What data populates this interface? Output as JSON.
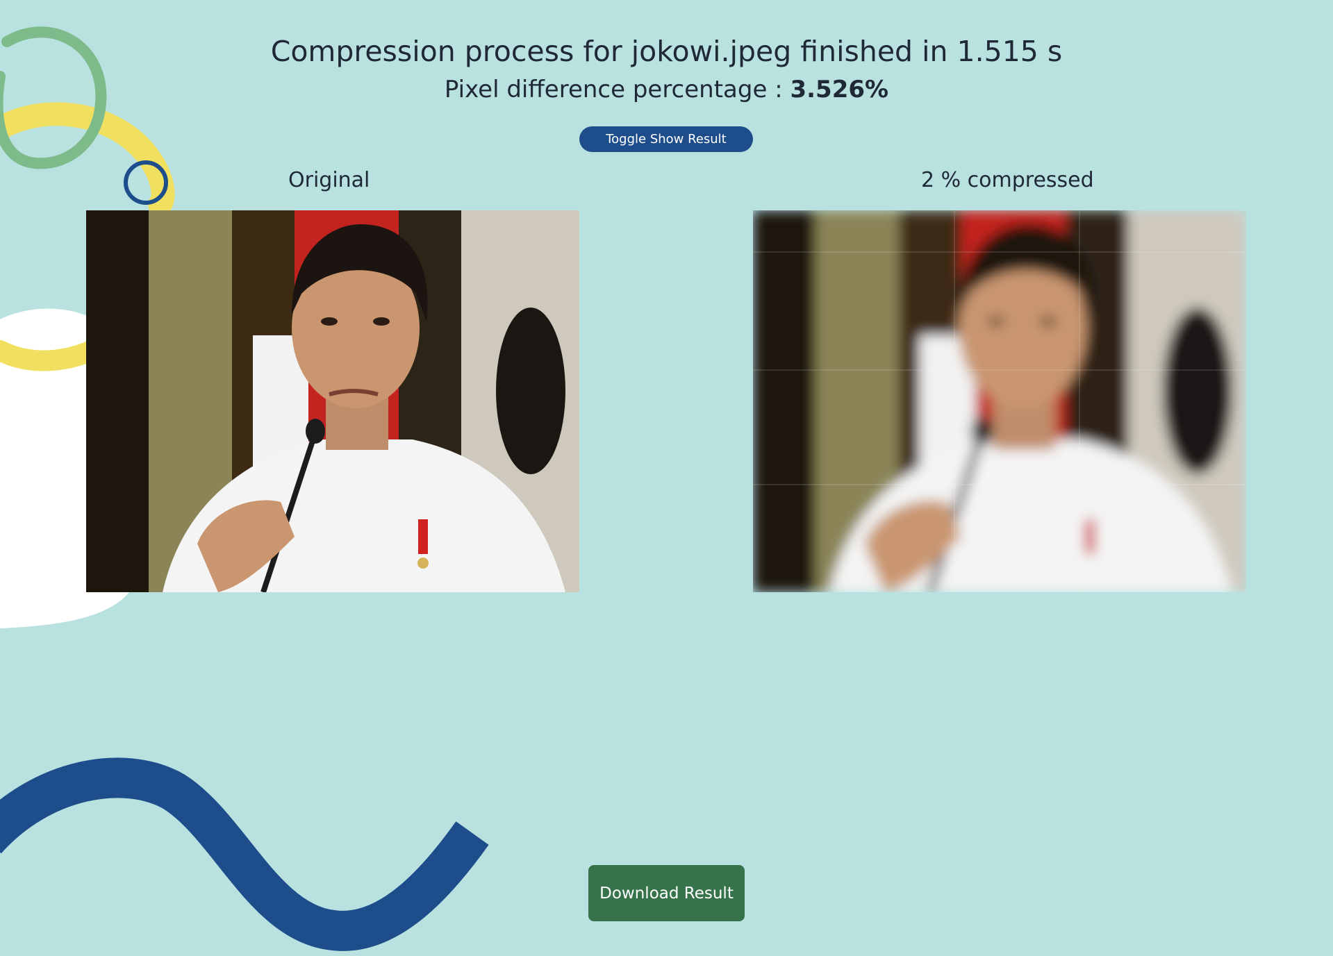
{
  "result": {
    "title": "Compression process for jokowi.jpeg finished in 1.515 s",
    "pixel_diff_label": "Pixel difference percentage : ",
    "pixel_diff_value": "3.526%"
  },
  "toggle_button_label": "Toggle Show Result",
  "images": {
    "original_label": "Original",
    "compressed_label": "2 % compressed"
  },
  "download_button_label": "Download Result",
  "colors": {
    "background": "#b9e1e0",
    "primary_button": "#1d4e8b",
    "download_button": "#36734b",
    "decor_green": "#7dbb8a",
    "decor_yellow": "#f1e060",
    "decor_blue": "#1d4e8b"
  }
}
